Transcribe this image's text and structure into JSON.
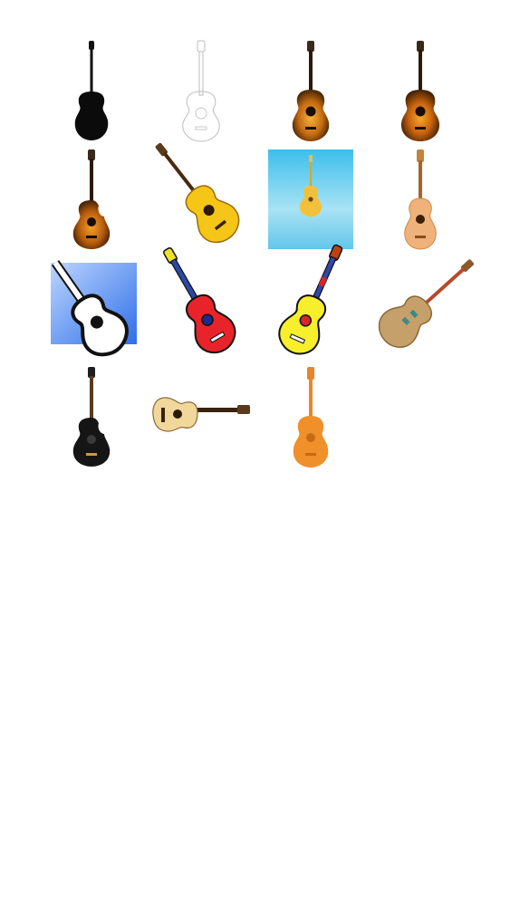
{
  "gallery": {
    "items": [
      {
        "icon": "black-silhouette-acoustic-guitar-icon"
      },
      {
        "icon": "outline-sketch-acoustic-guitar-icon"
      },
      {
        "icon": "sunburst-acoustic-guitar-icon"
      },
      {
        "icon": "sunburst-dreadnought-guitar-icon"
      },
      {
        "icon": "sunburst-cutaway-guitar-icon"
      },
      {
        "icon": "yellow-acoustic-guitar-icon"
      },
      {
        "icon": "guitar-on-blue-sky-icon"
      },
      {
        "icon": "natural-classical-guitar-icon"
      },
      {
        "icon": "guitar-app-logo-icon"
      },
      {
        "icon": "red-cartoon-guitar-icon"
      },
      {
        "icon": "yellow-cartoon-guitar-icon"
      },
      {
        "icon": "wooden-jazz-guitar-icon"
      },
      {
        "icon": "black-cutaway-acoustic-guitar-icon"
      },
      {
        "icon": "natural-cutaway-guitar-horizontal-icon"
      },
      {
        "icon": "orange-acoustic-guitar-icon"
      }
    ]
  },
  "colors": {
    "background": "#ffffff",
    "sunburst_dark": "#3a1d06",
    "sunburst_mid": "#b9630f",
    "sunburst_light": "#f5a623",
    "yellow_body": "#f5c518",
    "red_body": "#e8232a",
    "orange_body": "#f0902a",
    "tan_body": "#e7c38f",
    "sky_top": "#4cc5ec",
    "app_blue": "#4a86f0"
  }
}
